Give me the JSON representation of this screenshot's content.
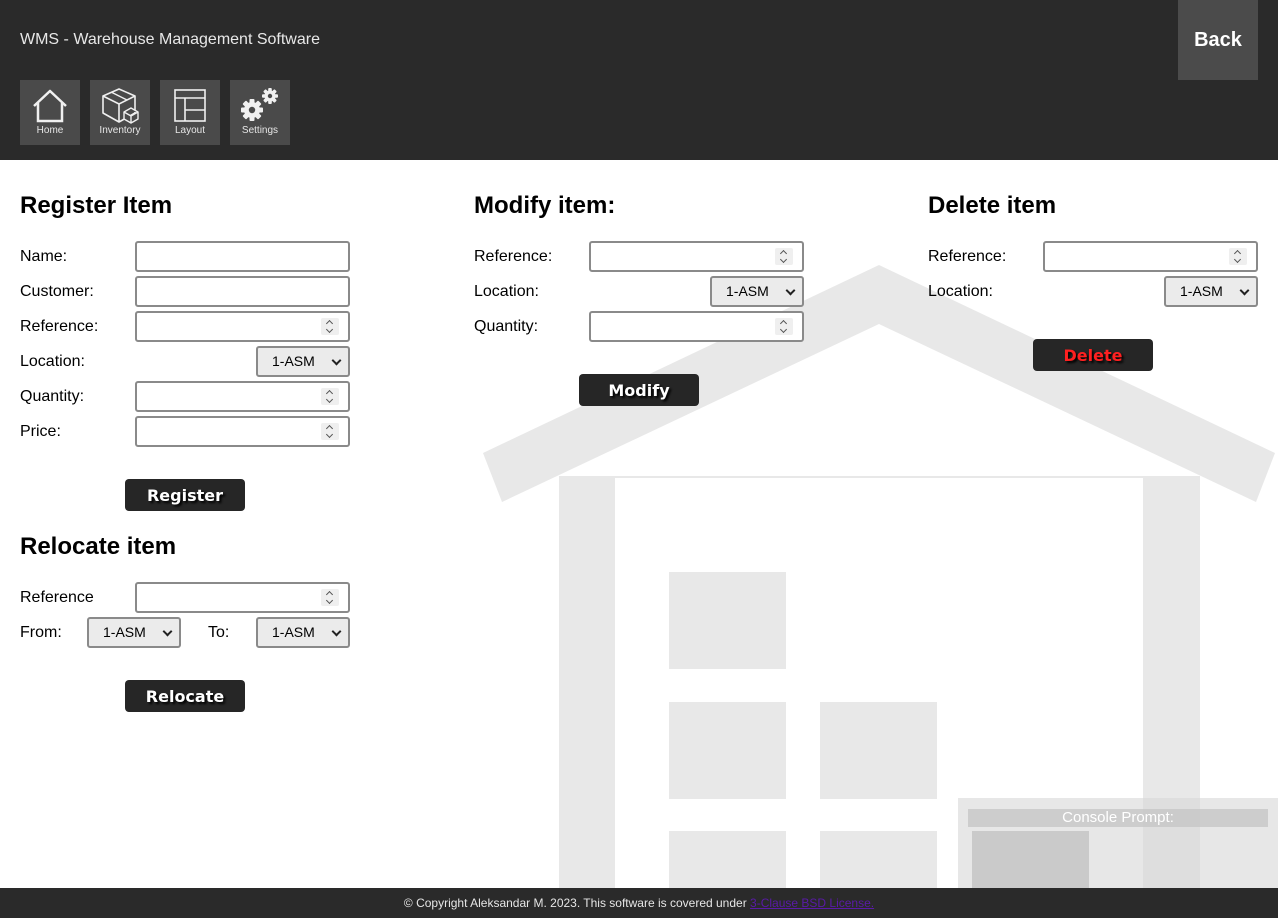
{
  "header": {
    "title": "WMS - Warehouse Management Software",
    "back_label": "Back",
    "nav": [
      {
        "label": "Home",
        "icon": "home-icon"
      },
      {
        "label": "Inventory",
        "icon": "box-icon"
      },
      {
        "label": "Layout",
        "icon": "layout-icon"
      },
      {
        "label": "Settings",
        "icon": "gear-icon"
      }
    ]
  },
  "register": {
    "title": "Register Item",
    "name_label": "Name:",
    "customer_label": "Customer:",
    "reference_label": "Reference:",
    "location_label": "Location:",
    "location_value": "1-ASM",
    "quantity_label": "Quantity:",
    "price_label": "Price:",
    "button": "Register"
  },
  "relocate": {
    "title": "Relocate item",
    "reference_label": "Reference",
    "from_label": "From:",
    "from_value": "1-ASM",
    "to_label": "To:",
    "to_value": "1-ASM",
    "button": "Relocate"
  },
  "modify": {
    "title": "Modify item:",
    "reference_label": "Reference:",
    "location_label": "Location:",
    "location_value": "1-ASM",
    "quantity_label": "Quantity:",
    "button": "Modify"
  },
  "delete": {
    "title": "Delete item",
    "reference_label": "Reference:",
    "location_label": "Location:",
    "location_value": "1-ASM",
    "button": "Delete"
  },
  "console": {
    "title": "Console Prompt:"
  },
  "footer": {
    "text": "© Copyright Aleksandar M. 2023. This software is covered under ",
    "link": "3-Clause BSD License."
  },
  "colors": {
    "header_bg": "#2a2a2a",
    "button_bg": "#262626",
    "delete_text": "#ff2020",
    "link": "#5a1aa8"
  }
}
